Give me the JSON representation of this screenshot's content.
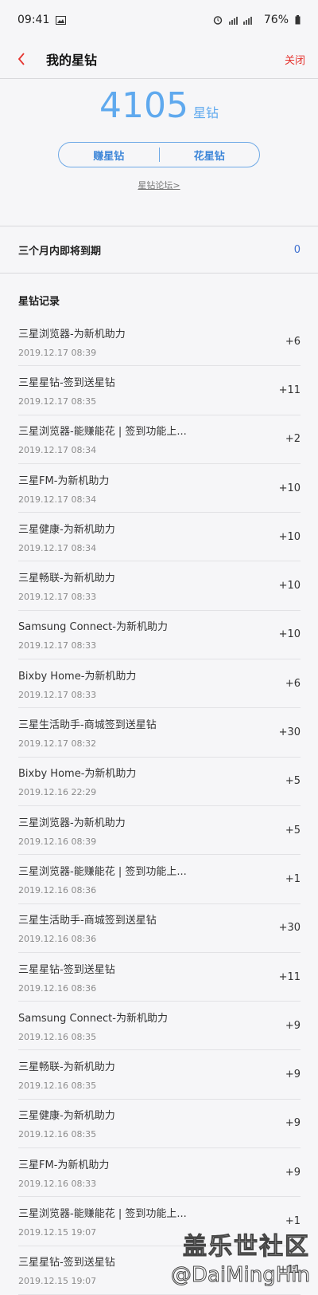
{
  "status_bar": {
    "time": "09:41",
    "battery": "76%"
  },
  "header": {
    "title": "我的星钻",
    "close_label": "关闭"
  },
  "summary": {
    "balance": "4105",
    "unit": "星钻",
    "earn_label": "赚星钻",
    "spend_label": "花星钻",
    "forum_link": "星钻论坛>"
  },
  "expiring": {
    "label": "三个月内即将到期",
    "value": "0"
  },
  "records": {
    "title": "星钻记录",
    "items": [
      {
        "name": "三星浏览器-为新机助力",
        "date": "2019.12.17 08:39",
        "amount": "+6"
      },
      {
        "name": "三星星钻-签到送星钻",
        "date": "2019.12.17 08:35",
        "amount": "+11"
      },
      {
        "name": "三星浏览器-能赚能花 | 签到功能上...",
        "date": "2019.12.17 08:34",
        "amount": "+2"
      },
      {
        "name": "三星FM-为新机助力",
        "date": "2019.12.17 08:34",
        "amount": "+10"
      },
      {
        "name": "三星健康-为新机助力",
        "date": "2019.12.17 08:34",
        "amount": "+10"
      },
      {
        "name": "三星畅联-为新机助力",
        "date": "2019.12.17 08:33",
        "amount": "+10"
      },
      {
        "name": "Samsung Connect-为新机助力",
        "date": "2019.12.17 08:33",
        "amount": "+10"
      },
      {
        "name": "Bixby Home-为新机助力",
        "date": "2019.12.17 08:33",
        "amount": "+6"
      },
      {
        "name": "三星生活助手-商城签到送星钻",
        "date": "2019.12.17 08:32",
        "amount": "+30"
      },
      {
        "name": "Bixby Home-为新机助力",
        "date": "2019.12.16 22:29",
        "amount": "+5"
      },
      {
        "name": "三星浏览器-为新机助力",
        "date": "2019.12.16 08:39",
        "amount": "+5"
      },
      {
        "name": "三星浏览器-能赚能花 | 签到功能上...",
        "date": "2019.12.16 08:36",
        "amount": "+1"
      },
      {
        "name": "三星生活助手-商城签到送星钻",
        "date": "2019.12.16 08:36",
        "amount": "+30"
      },
      {
        "name": "三星星钻-签到送星钻",
        "date": "2019.12.16 08:36",
        "amount": "+11"
      },
      {
        "name": "Samsung Connect-为新机助力",
        "date": "2019.12.16 08:35",
        "amount": "+9"
      },
      {
        "name": "三星畅联-为新机助力",
        "date": "2019.12.16 08:35",
        "amount": "+9"
      },
      {
        "name": "三星健康-为新机助力",
        "date": "2019.12.16 08:35",
        "amount": "+9"
      },
      {
        "name": "三星FM-为新机助力",
        "date": "2019.12.16 08:33",
        "amount": "+9"
      },
      {
        "name": "三星浏览器-能赚能花 | 签到功能上...",
        "date": "2019.12.15 19:07",
        "amount": "+1"
      },
      {
        "name": "三星星钻-签到送星钻",
        "date": "2019.12.15 19:07",
        "amount": "+11"
      }
    ]
  },
  "watermark": {
    "line1": "盖乐世社区",
    "line2": "@DaiMingHin"
  }
}
